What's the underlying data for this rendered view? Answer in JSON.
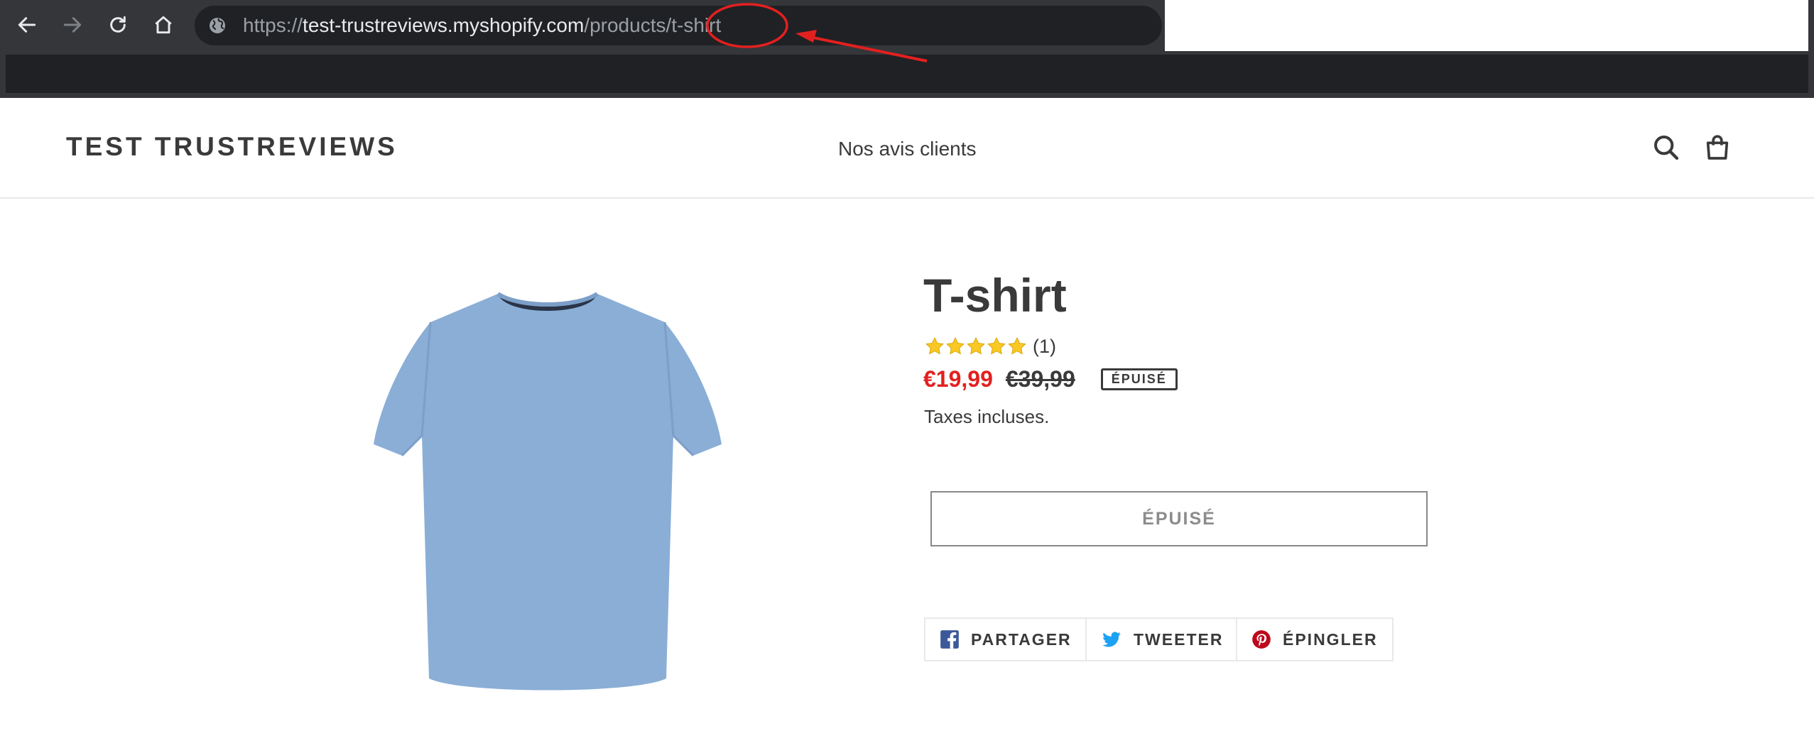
{
  "browser": {
    "url_scheme": "https://",
    "url_host": "test-trustreviews.myshopify.com",
    "url_path": "/products/",
    "url_highlight": "t-shirt"
  },
  "header": {
    "logo": "TEST TRUSTREVIEWS",
    "nav_link": "Nos avis clients"
  },
  "product": {
    "title": "T-shirt",
    "rating": 5,
    "rating_max": 5,
    "reviews_count": "(1)",
    "sale_price": "€19,99",
    "regular_price": "€39,99",
    "sold_out_badge": "ÉPUISÉ",
    "tax_note": "Taxes incluses.",
    "sold_out_button": "ÉPUISÉ"
  },
  "share": {
    "facebook": "PARTAGER",
    "twitter": "TWEETER",
    "pinterest": "ÉPINGLER"
  },
  "colors": {
    "sale_price": "#e22120",
    "star": "#f9c824",
    "annotation": "#e32020",
    "facebook": "#3b5998",
    "twitter": "#1da1f2",
    "pinterest": "#bd081c",
    "tshirt": "#8aaed6"
  }
}
